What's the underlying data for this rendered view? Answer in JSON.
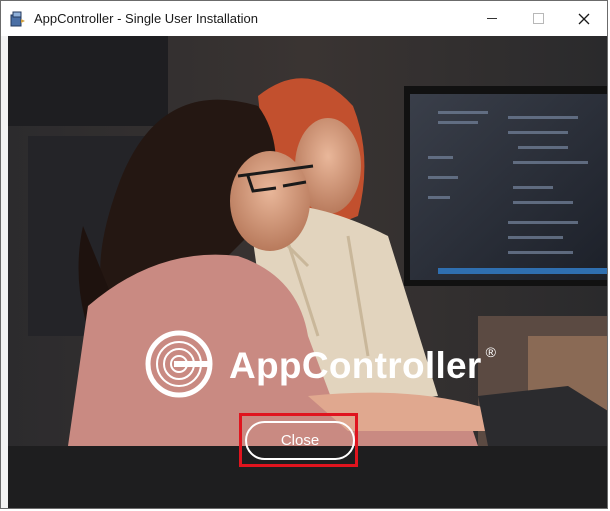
{
  "window": {
    "title": "AppController - Single User Installation",
    "app_icon": "installer-icon"
  },
  "titlebar_buttons": {
    "minimize_glyph": "—",
    "maximize_glyph": "",
    "close_glyph": "✕"
  },
  "hero": {
    "brand_name": "AppController",
    "registered_mark": "®",
    "image_icon": "photo-two-people-at-computer"
  },
  "footer": {
    "close_label": "Close"
  },
  "colors": {
    "background": "#1d1d1e",
    "highlight": "#e0141e",
    "text": "#ffffff"
  }
}
